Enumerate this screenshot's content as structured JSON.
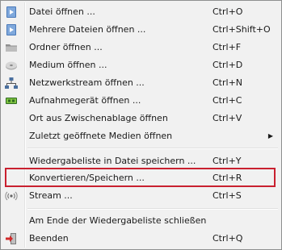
{
  "menu": {
    "items": [
      {
        "label": "Datei öffnen ...",
        "shortcut": "Ctrl+O",
        "icon": "play-file-icon"
      },
      {
        "label": "Mehrere Dateien öffnen ...",
        "shortcut": "Ctrl+Shift+O",
        "icon": "play-file-icon"
      },
      {
        "label": "Ordner öffnen ...",
        "shortcut": "Ctrl+F",
        "icon": "folder-icon"
      },
      {
        "label": "Medium öffnen ...",
        "shortcut": "Ctrl+D",
        "icon": "disc-icon"
      },
      {
        "label": "Netzwerkstream öffnen ...",
        "shortcut": "Ctrl+N",
        "icon": "network-icon"
      },
      {
        "label": "Aufnahmegerät öffnen ...",
        "shortcut": "Ctrl+C",
        "icon": "capture-card-icon"
      },
      {
        "label": "Ort aus Zwischenablage öffnen",
        "shortcut": "Ctrl+V",
        "icon": ""
      },
      {
        "label": "Zuletzt geöffnete Medien öffnen",
        "shortcut": "",
        "icon": "",
        "submenu": "▶"
      },
      {
        "label": "Wiedergabeliste in Datei speichern ...",
        "shortcut": "Ctrl+Y",
        "icon": ""
      },
      {
        "label": "Konvertieren/Speichern ...",
        "shortcut": "Ctrl+R",
        "icon": ""
      },
      {
        "label": "Stream ...",
        "shortcut": "Ctrl+S",
        "icon": "stream-icon"
      },
      {
        "label": "Am Ende der Wiedergabeliste schließen",
        "shortcut": "",
        "icon": ""
      },
      {
        "label": "Beenden",
        "shortcut": "Ctrl+Q",
        "icon": "exit-icon"
      }
    ],
    "highlighted_item": "Konvertieren/Speichern ...",
    "highlight_color": "#c9202f"
  }
}
